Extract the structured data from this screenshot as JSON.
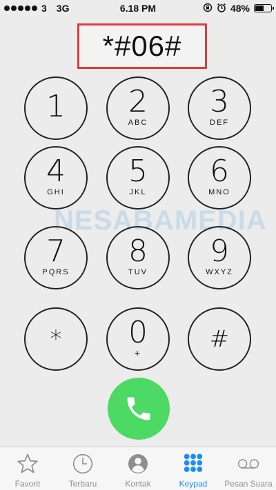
{
  "status_bar": {
    "carrier": "3",
    "network": "3G",
    "time": "6.18 PM",
    "battery_percent": "48%",
    "battery_level": 0.48,
    "signal_dots": 5
  },
  "display": {
    "number": "*#06#"
  },
  "watermark": {
    "text": "NESABAMEDIA"
  },
  "keypad": {
    "keys": [
      {
        "digit": "1",
        "letters": ""
      },
      {
        "digit": "2",
        "letters": "ABC"
      },
      {
        "digit": "3",
        "letters": "DEF"
      },
      {
        "digit": "4",
        "letters": "GHI"
      },
      {
        "digit": "5",
        "letters": "JKL"
      },
      {
        "digit": "6",
        "letters": "MNO"
      },
      {
        "digit": "7",
        "letters": "PQRS"
      },
      {
        "digit": "8",
        "letters": "TUV"
      },
      {
        "digit": "9",
        "letters": "WXYZ"
      },
      {
        "digit": "*",
        "letters": ""
      },
      {
        "digit": "0",
        "letters": "+"
      },
      {
        "digit": "#",
        "letters": ""
      }
    ]
  },
  "call_button": {
    "icon": "phone-icon",
    "color": "#4cd964"
  },
  "tab_bar": {
    "active_color": "#1a8cff",
    "tabs": [
      {
        "label": "Favorit",
        "icon": "star-icon"
      },
      {
        "label": "Terbaru",
        "icon": "clock-icon"
      },
      {
        "label": "Kontak",
        "icon": "contact-icon"
      },
      {
        "label": "Keypad",
        "icon": "keypad-icon"
      },
      {
        "label": "Pesan Suara",
        "icon": "voicemail-icon"
      }
    ]
  }
}
